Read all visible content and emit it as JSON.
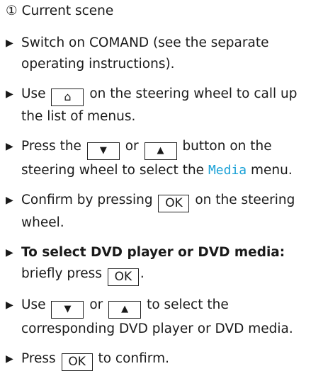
{
  "caption": {
    "number": "①",
    "text": "Current scene"
  },
  "bullet": "▶",
  "keys": {
    "home_symbol": "⌂",
    "down_symbol": "▼",
    "up_symbol": "▲",
    "ok_label": "OK"
  },
  "accent_color": "#1aa1d6",
  "steps": [
    {
      "line1": "Switch on COMAND (see the separate",
      "line2": "operating instructions)."
    },
    {
      "pre": "Use",
      "post": "on the steering wheel to call up",
      "line2": "the list of menus."
    },
    {
      "pre": "Press the",
      "mid": "or",
      "post": "button on the",
      "line2_pre": "steering wheel to select the",
      "media": "Media",
      "line2_post": "menu."
    },
    {
      "pre": "Confirm by pressing",
      "post": "on the steering",
      "line2": "wheel."
    },
    {
      "bold": "To select DVD player or DVD media:",
      "line2_pre": "briefly press",
      "line2_post": "."
    },
    {
      "pre": "Use",
      "mid": "or",
      "post": "to select the",
      "line2": "corresponding DVD player or DVD media."
    },
    {
      "pre": "Press",
      "post": "to confirm."
    }
  ]
}
